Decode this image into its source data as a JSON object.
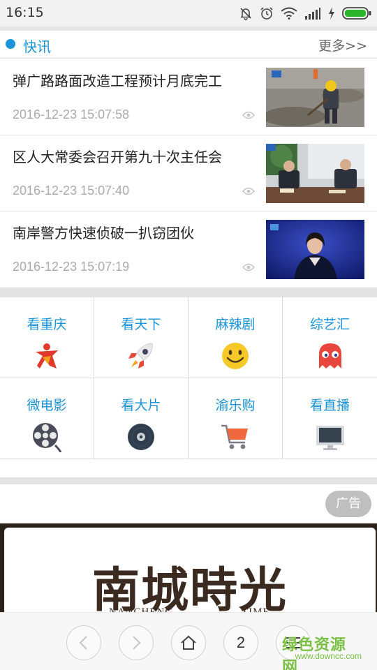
{
  "status_bar": {
    "time": "16:15",
    "icons": [
      "mute-bell-icon",
      "alarm-icon",
      "wifi-icon",
      "signal-icon",
      "charging-icon",
      "battery-icon"
    ],
    "battery_color": "#2ab52a"
  },
  "news": {
    "title": "快讯",
    "more": "更多>>",
    "accent": "#1a93d8",
    "items": [
      {
        "title": "弹广路路面改造工程预计月底完工",
        "date": "2016-12-23 15:07:58",
        "thumb": "road-worker-photo"
      },
      {
        "title": "区人大常委会召开第九十次主任会",
        "date": "2016-12-23 15:07:40",
        "thumb": "meeting-photo"
      },
      {
        "title": "南岸警方快速侦破一扒窃团伙",
        "date": "2016-12-23 15:07:19",
        "thumb": "news-anchor-photo"
      }
    ]
  },
  "categories": [
    {
      "label": "看重庆",
      "icon": "chongqing-logo-icon"
    },
    {
      "label": "看天下",
      "icon": "rocket-icon"
    },
    {
      "label": "麻辣剧",
      "icon": "smiley-icon"
    },
    {
      "label": "综艺汇",
      "icon": "ghost-icon"
    },
    {
      "label": "微电影",
      "icon": "film-reel-icon"
    },
    {
      "label": "看大片",
      "icon": "disc-icon"
    },
    {
      "label": "渝乐购",
      "icon": "shopping-cart-icon"
    },
    {
      "label": "看直播",
      "icon": "tv-monitor-icon"
    }
  ],
  "ad": {
    "tag": "广告",
    "banner_title": "南城時光",
    "banner_sub_left": "NANCHENG",
    "banner_sub_right": "TIME"
  },
  "bottom_bar": {
    "tab_count": "2",
    "buttons": [
      "back-icon",
      "forward-icon",
      "home-icon",
      "tabs-counter",
      "menu-icon"
    ]
  },
  "watermark": {
    "main": "绿色资源网",
    "url": "www.downcc.com"
  }
}
